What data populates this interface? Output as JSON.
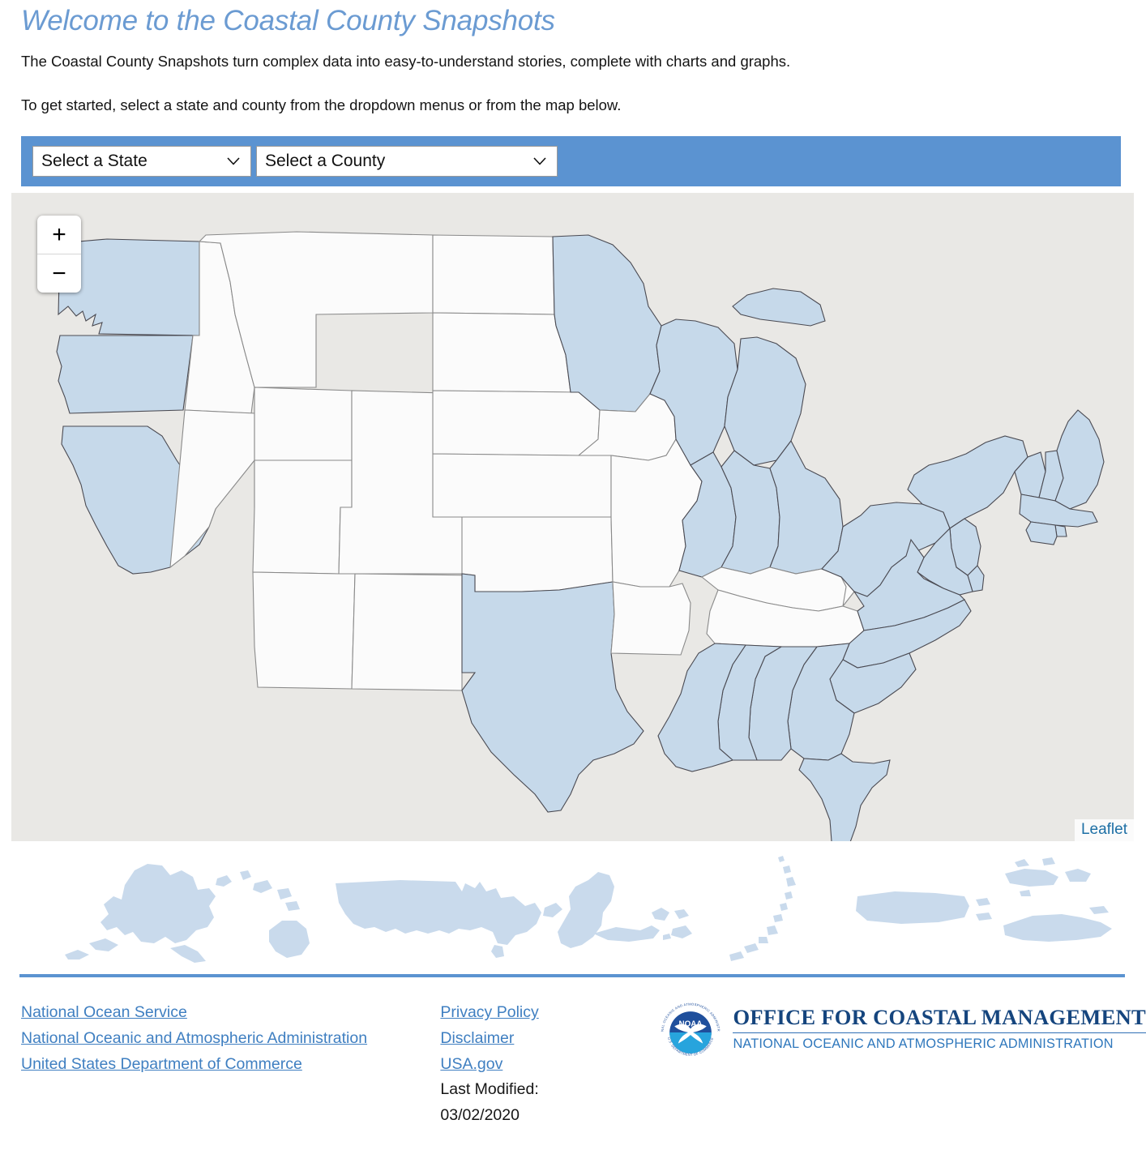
{
  "header": {
    "title": "Welcome to the Coastal County Snapshots",
    "paragraph_1": "The Coastal County Snapshots turn complex data into easy-to-understand stories, complete with charts and graphs.",
    "paragraph_2": "To get started, select a state and county from the dropdown menus or from the map below."
  },
  "selectors": {
    "state": {
      "value": "Select a State",
      "icon": "chevron-down-icon"
    },
    "county": {
      "value": "Select a County",
      "icon": "chevron-down-icon"
    }
  },
  "map": {
    "zoom_in_label": "+",
    "zoom_out_label": "−",
    "attribution": "Leaflet",
    "coastal_fill": "#c6d9ea",
    "inland_fill": "#fbfbfb",
    "background": "#e9e8e5",
    "coastal_states": [
      "Washington",
      "Oregon",
      "California",
      "Minnesota",
      "Wisconsin",
      "Michigan",
      "Illinois",
      "Indiana",
      "Ohio",
      "Pennsylvania",
      "New York",
      "Vermont",
      "New Hampshire",
      "Maine",
      "Massachusetts",
      "Rhode Island",
      "Connecticut",
      "New Jersey",
      "Delaware",
      "Maryland",
      "Virginia",
      "North Carolina",
      "South Carolina",
      "Georgia",
      "Florida",
      "Alabama",
      "Mississippi",
      "Louisiana",
      "Texas"
    ],
    "inland_states": [
      "Idaho",
      "Nevada",
      "Montana",
      "Wyoming",
      "Utah",
      "Arizona",
      "Colorado",
      "New Mexico",
      "North Dakota",
      "South Dakota",
      "Nebraska",
      "Kansas",
      "Oklahoma",
      "Iowa",
      "Missouri",
      "Arkansas",
      "Tennessee",
      "Kentucky",
      "West Virginia"
    ]
  },
  "territories": [
    {
      "name": "Alaska",
      "icon": "alaska-map-icon"
    },
    {
      "name": "Hawaii",
      "icon": "hawaii-map-icon"
    },
    {
      "name": "Continental United States",
      "icon": "conus-map-icon"
    },
    {
      "name": "Guam",
      "icon": "guam-map-icon"
    },
    {
      "name": "American Samoa",
      "icon": "american-samoa-map-icon"
    },
    {
      "name": "Northern Mariana Islands",
      "icon": "northern-mariana-islands-map-icon"
    },
    {
      "name": "Puerto Rico",
      "icon": "puerto-rico-map-icon"
    },
    {
      "name": "U.S. Virgin Islands",
      "icon": "us-virgin-islands-map-icon"
    }
  ],
  "footer": {
    "column_1": [
      "National Ocean Service",
      "National Oceanic and Atmospheric Administration",
      "United States Department of Commerce"
    ],
    "column_2": [
      "Privacy Policy",
      "Disclaimer",
      "USA.gov"
    ],
    "last_modified_label": "Last Modified:",
    "last_modified_date": "03/02/2020",
    "logo": {
      "seal_text": "NOAA",
      "ring_text_top": "NATIONAL OCEANIC AND ATMOSPHERIC ADMINISTRATION",
      "ring_text_bottom": "U.S. DEPARTMENT OF COMMERCE",
      "title": "OFFICE FOR COASTAL MANAGEMENT",
      "subtitle": "NATIONAL OCEANIC AND ATMOSPHERIC ADMINISTRATION"
    }
  },
  "colors": {
    "accent_blue": "#5b93d1",
    "title_blue": "#6b9bd2",
    "link_blue": "#3f7fc1",
    "noaa_navy": "#15457e"
  }
}
